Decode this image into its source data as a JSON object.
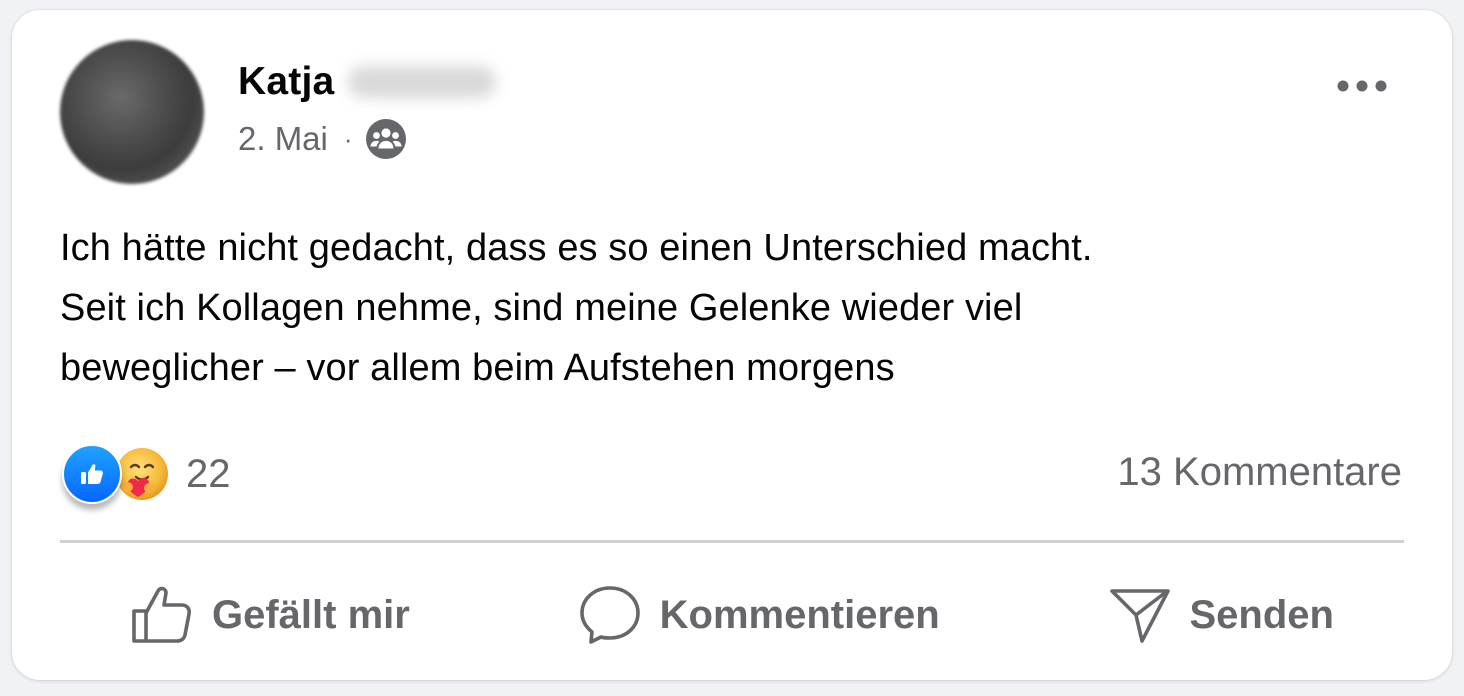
{
  "post": {
    "author": {
      "first_name": "Katja",
      "avatar_icon": "blurred-profile-photo"
    },
    "date": "2. Mai",
    "separator": "·",
    "audience_icon": "group-audience-icon",
    "more_icon": "more-horizontal-icon",
    "text_lines": [
      "Ich hätte nicht gedacht, dass es so einen Unterschied macht.",
      "Seit ich Kollagen nehme, sind meine Gelenke wieder viel",
      "beweglicher – vor allem beim Aufstehen morgens"
    ],
    "reactions": {
      "icons": [
        "like-reaction-icon",
        "care-reaction-icon"
      ],
      "count": "22"
    },
    "comments_label": "13 Kommentare",
    "actions": {
      "like_label": "Gefällt mir",
      "comment_label": "Kommentieren",
      "share_label": "Senden"
    }
  },
  "colors": {
    "card_background": "#ffffff",
    "page_background": "#f0f2f5",
    "text_primary": "#050505",
    "text_secondary": "#65676b",
    "like_blue": "#0866ff",
    "divider": "#ced0d4"
  }
}
